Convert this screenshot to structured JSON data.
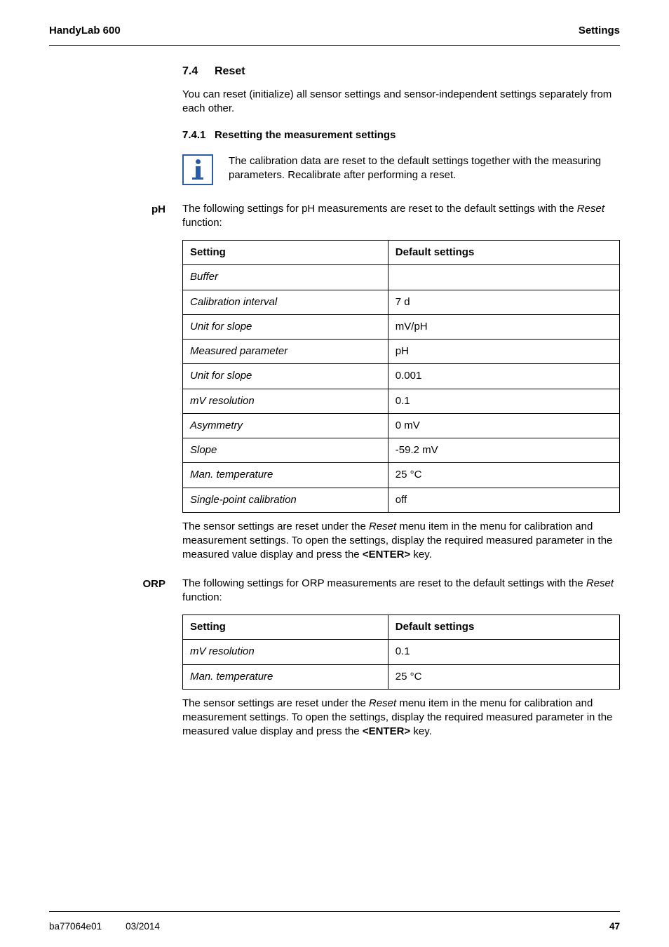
{
  "header": {
    "left": "HandyLab 600",
    "right": "Settings"
  },
  "sec": {
    "num": "7.4",
    "title": "Reset",
    "intro": "You can reset (initialize) all sensor settings and sensor-independent settings  separately from each other."
  },
  "subsec": {
    "num": "7.4.1",
    "title": "Resetting the measurement settings",
    "note": "The calibration data are reset to the default settings together with the measuring parameters. Recalibrate after performing a reset."
  },
  "ph": {
    "label": "pH",
    "intro_a": "The following settings for pH measurements are reset to the default settings with the ",
    "intro_it": "Reset",
    "intro_b": " function:",
    "cols": [
      "Setting",
      "Default settings"
    ],
    "rows": [
      [
        "Buffer",
        ""
      ],
      [
        "Calibration interval",
        "7 d"
      ],
      [
        "Unit for slope",
        "mV/pH"
      ],
      [
        "Measured parameter",
        "pH"
      ],
      [
        "Unit for slope",
        "0.001"
      ],
      [
        "mV resolution",
        "0.1"
      ],
      [
        "Asymmetry",
        "0 mV"
      ],
      [
        "Slope",
        "-59.2 mV"
      ],
      [
        "Man. temperature",
        " 25  °C"
      ],
      [
        "Single-point calibration",
        "off"
      ]
    ],
    "after_a": "The sensor settings are reset under the ",
    "after_it": "Reset",
    "after_b": " menu item in the menu for calibration and measurement settings. To open the settings, display the required measured parameter in the measured value display and press the ",
    "after_key": "<ENTER>",
    "after_c": " key."
  },
  "orp": {
    "label": "ORP",
    "intro_a": "The following settings for ORP measurements are reset to the default settings with the ",
    "intro_it": "Reset",
    "intro_b": " function:",
    "cols": [
      "Setting",
      "Default settings"
    ],
    "rows": [
      [
        "mV resolution",
        "0.1"
      ],
      [
        "Man. temperature",
        " 25  °C"
      ]
    ],
    "after_a": "The sensor settings are reset under the ",
    "after_it": "Reset",
    "after_b": " menu item in the menu for calibration and measurement settings. To open the settings, display the required measured parameter in the measured value display and press the ",
    "after_key": "<ENTER>",
    "after_c": " key."
  },
  "footer": {
    "doc": "ba77064e01",
    "date": "03/2014",
    "page": "47"
  }
}
